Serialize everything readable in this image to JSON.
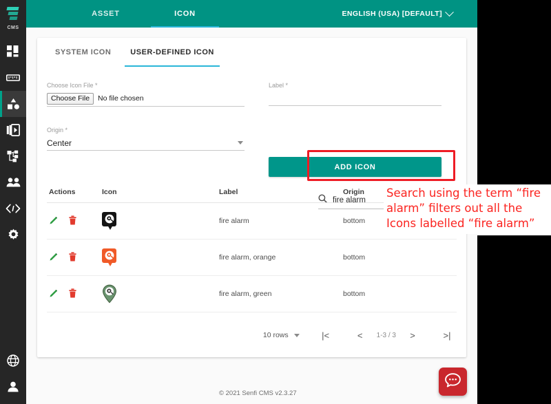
{
  "brand": {
    "logo_name": "senfi-logo",
    "label": "CMS"
  },
  "sidebar": {
    "items": [
      {
        "name": "dashboard",
        "icon": "dashboard-icon",
        "active": false
      },
      {
        "name": "ruler",
        "icon": "ruler-icon",
        "active": false
      },
      {
        "name": "assets",
        "icon": "shapes-icon",
        "active": true
      },
      {
        "name": "media",
        "icon": "media-library-icon",
        "active": false
      },
      {
        "name": "sitemap",
        "icon": "sitemap-icon",
        "active": false
      },
      {
        "name": "users",
        "icon": "users-icon",
        "active": false
      },
      {
        "name": "developer",
        "icon": "code-icon",
        "active": false
      },
      {
        "name": "settings",
        "icon": "gear-icon",
        "active": false
      }
    ],
    "bottom_items": [
      {
        "name": "language",
        "icon": "globe-icon"
      },
      {
        "name": "account",
        "icon": "person-icon"
      }
    ]
  },
  "topbar": {
    "tabs": [
      {
        "label": "ASSET",
        "active": false
      },
      {
        "label": "ICON",
        "active": true
      }
    ],
    "language": "ENGLISH (USA) [DEFAULT]",
    "language_chevron": "chevron-down-icon"
  },
  "subtabs": [
    {
      "label": "SYSTEM ICON",
      "active": false
    },
    {
      "label": "USER-DEFINED ICON",
      "active": true
    }
  ],
  "form": {
    "file_field": {
      "label": "Choose Icon File *",
      "button_label": "Choose File",
      "status": "No file chosen"
    },
    "label_field": {
      "label": "Label *",
      "value": "",
      "placeholder": ""
    },
    "origin_field": {
      "label": "Origin *",
      "value": "Center"
    },
    "add_button": "ADD ICON"
  },
  "search": {
    "icon": "search-icon",
    "value": "fire alarm",
    "placeholder": "",
    "clear_icon": "close-icon"
  },
  "table": {
    "headers": [
      "Actions",
      "Icon",
      "Label",
      "Origin"
    ],
    "rows": [
      {
        "icon_kind": "marker-black",
        "label": "fire alarm",
        "origin": "bottom"
      },
      {
        "icon_kind": "marker-orange",
        "label": "fire alarm, orange",
        "origin": "bottom"
      },
      {
        "icon_kind": "pin-green",
        "label": "fire alarm, green",
        "origin": "bottom"
      }
    ],
    "action_icons": [
      "edit-pencil-icon",
      "delete-trash-icon"
    ]
  },
  "pagination": {
    "rows_per_page": "10 rows",
    "rows_caret": "caret-down-icon",
    "first_label": "|<",
    "prev_label": "<",
    "range": "1-3 / 3",
    "next_label": ">",
    "last_label": ">|"
  },
  "footer": {
    "copyright": "© 2021 Senfi CMS v2.3.27"
  },
  "chat": {
    "icon": "chat-bubble-icon"
  },
  "annotation": {
    "text": "Search using the term “fire alarm” filters out all the Icons labelled “fire alarm”",
    "color": "#fb2420"
  },
  "colors": {
    "teal": "#009383",
    "sidebar": "#262626",
    "accent_underline": "#29b6d8",
    "button_teal": "#00968a",
    "highlight_red": "#ee1c25",
    "chat_red": "#c9272d",
    "trash_red": "#e23b2e",
    "pencil_green": "#2f9e44"
  }
}
